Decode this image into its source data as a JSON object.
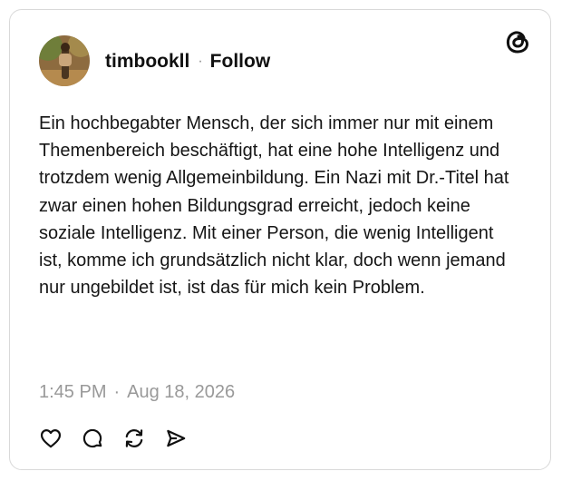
{
  "post": {
    "author": "timbookll",
    "separator": "·",
    "follow_label": "Follow",
    "text": "Ein hochbegabter Mensch, der sich immer nur mit einem Themenbereich beschäftigt, hat eine hohe Intelligenz und trotzdem wenig Allgemeinbildung. Ein Nazi mit Dr.-Titel hat zwar einen hohen Bildungsgrad erreicht, jedoch keine soziale Intelligenz. Mit einer Person, die wenig Intelligent ist, komme ich grundsätzlich nicht klar, doch wenn jemand nur ungebildet ist, ist das für mich kein Problem.",
    "time": "1:45 PM",
    "date_separator": "·",
    "date": "Aug 18, 2026"
  },
  "icons": {
    "logo": "threads-logo-icon",
    "like": "heart-icon",
    "reply": "comment-icon",
    "repost": "repost-icon",
    "share": "send-icon"
  },
  "colors": {
    "text": "#101010",
    "muted": "#999999",
    "border": "#d9d9d9"
  }
}
